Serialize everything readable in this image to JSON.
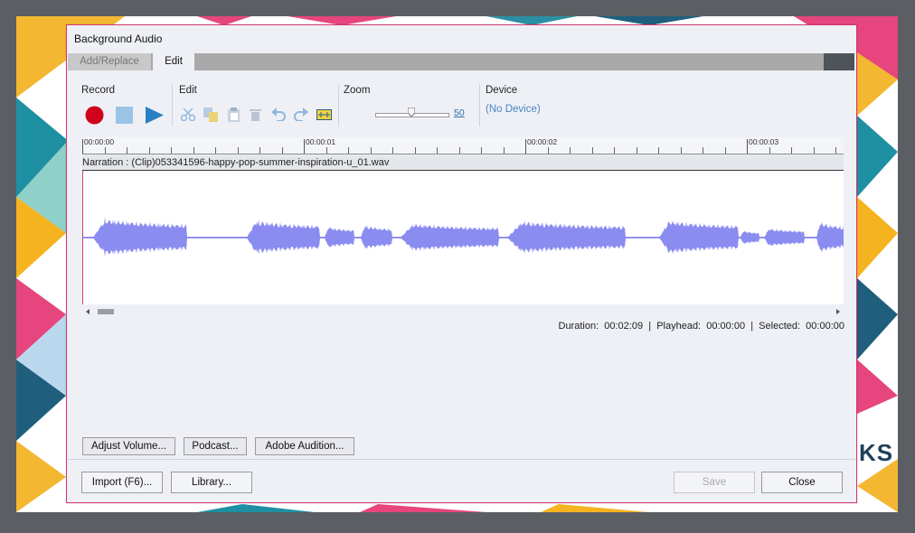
{
  "dialog": {
    "title": "Background Audio"
  },
  "tabs": [
    {
      "label": "Add/Replace"
    },
    {
      "label": "Edit"
    }
  ],
  "toolbar": {
    "record": {
      "label": "Record"
    },
    "edit": {
      "label": "Edit"
    },
    "zoom": {
      "label": "Zoom",
      "value": "50",
      "level": 0.5
    },
    "device": {
      "label": "Device",
      "value": "(No Device)"
    }
  },
  "timeline": {
    "ticks": [
      "00:00:00",
      "00:00:01",
      "00:00:02",
      "00:00:03"
    ],
    "track_label": "Narration : (Clip)053341596-happy-pop-summer-inspiration-u_01.wav"
  },
  "status": {
    "duration_label": "Duration:",
    "duration": "00:02:09",
    "playhead_label": "Playhead:",
    "playhead": "00:00:00",
    "selected_label": "Selected:",
    "selected": "00:00:00"
  },
  "buttons": {
    "adjust_volume": "Adjust Volume...",
    "podcast": "Podcast...",
    "audition": "Adobe Audition...",
    "import": "Import (F6)...",
    "library": "Library...",
    "save": "Save",
    "close": "Close"
  },
  "background": {
    "logo_text": "KS"
  },
  "colors": {
    "accent": "#d9356f",
    "waveform": "#8a8cf0",
    "record": "#d0021b",
    "play": "#2a7fc4"
  }
}
